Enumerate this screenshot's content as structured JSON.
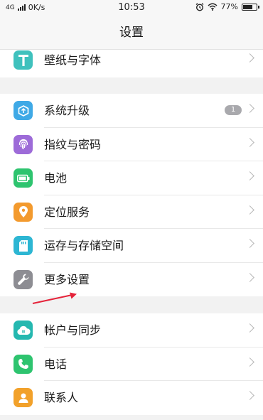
{
  "status_bar": {
    "network": "4G",
    "speed": "0K/s",
    "time": "10:53",
    "battery_percent": "77%",
    "battery_level": 0.77
  },
  "header": {
    "title": "设置"
  },
  "groups": [
    {
      "items": [
        {
          "label": "壁纸与字体",
          "icon": "font-t-icon",
          "color": "#3fc1bd"
        }
      ]
    },
    {
      "items": [
        {
          "label": "系统升级",
          "icon": "system-update-icon",
          "color": "#3fa9e6",
          "badge": "1"
        },
        {
          "label": "指纹与密码",
          "icon": "fingerprint-icon",
          "color": "#9d6bd8"
        },
        {
          "label": "电池",
          "icon": "battery-icon",
          "color": "#2ec46f"
        },
        {
          "label": "定位服务",
          "icon": "location-pin-icon",
          "color": "#f39a2e"
        },
        {
          "label": "运存与存储空间",
          "icon": "storage-card-icon",
          "color": "#2db6d3"
        },
        {
          "label": "更多设置",
          "icon": "wrench-icon",
          "color": "#8d8d93"
        }
      ]
    },
    {
      "items": [
        {
          "label": "帐户与同步",
          "icon": "cloud-sync-icon",
          "color": "#25b8b0"
        },
        {
          "label": "电话",
          "icon": "phone-icon",
          "color": "#2ec46f"
        },
        {
          "label": "联系人",
          "icon": "contact-icon",
          "color": "#f2a12a"
        }
      ]
    }
  ],
  "annotation": {
    "arrow_color": "#e5233a",
    "arrow_target": "更多设置"
  }
}
